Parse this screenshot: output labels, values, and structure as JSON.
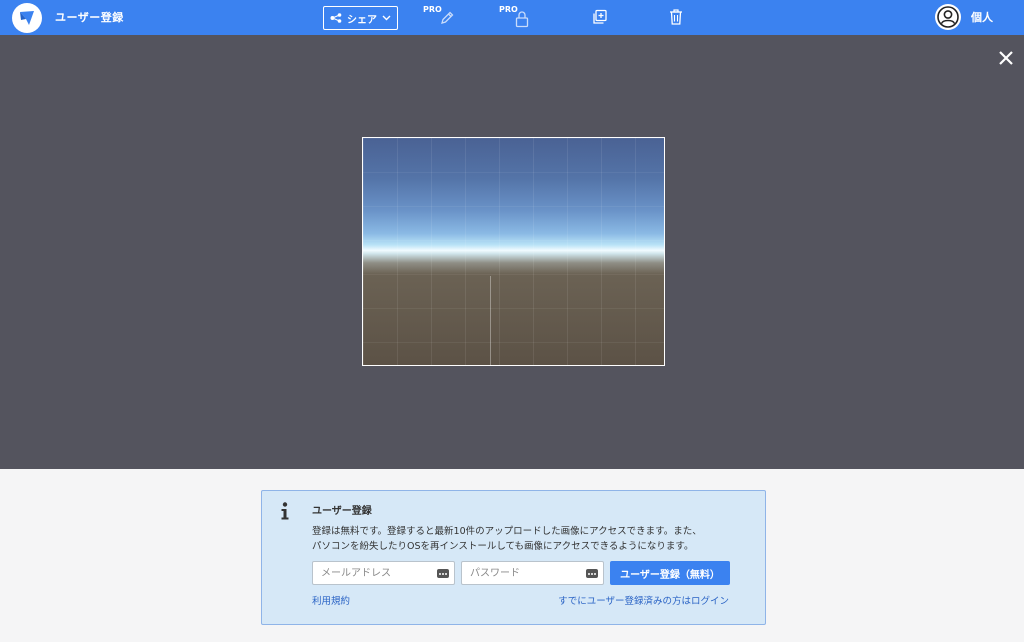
{
  "header": {
    "title": "ユーザー登録",
    "share_label": "シェア",
    "pro_label": "PRO",
    "user_name": "個人",
    "icons": {
      "logo": "app-logo-icon",
      "share": "share-icon",
      "dropdown": "chevron-down-icon",
      "edit": "pencil-icon",
      "lock": "lock-icon",
      "duplicate": "duplicate-icon",
      "delete": "trash-icon",
      "avatar": "user-avatar-icon"
    },
    "colors": {
      "bar": "#3b82f0"
    }
  },
  "viewer": {
    "close_icon": "close-icon",
    "background": "#54545e"
  },
  "register": {
    "title": "ユーザー登録",
    "line1": "登録は無料です。登録すると最新10件のアップロードした画像にアクセスできます。また、",
    "line2": "パソコンを紛失したりOSを再インストールしても画像にアクセスできるようになります。",
    "email_placeholder": "メールアドレス",
    "password_placeholder": "パスワード",
    "submit_label": "ユーザー登録（無料）",
    "terms_link": "利用規約",
    "login_link": "すでにユーザー登録済みの方はログイン",
    "colors": {
      "card": "#d6e8f7",
      "link": "#2a63c5"
    }
  }
}
